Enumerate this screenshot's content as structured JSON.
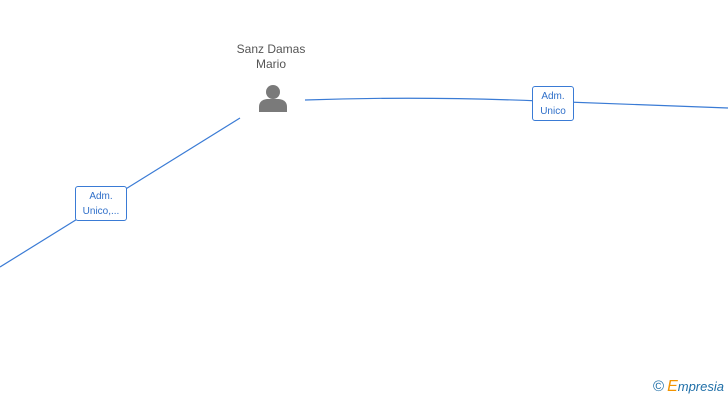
{
  "nodes": {
    "person": {
      "name_line1": "Sanz Damas",
      "name_line2": "Mario",
      "icon": "person-icon",
      "icon_color": "#7a7a7a"
    }
  },
  "edges": {
    "color": "#3a7bd5",
    "left": {
      "label_line1": "Adm.",
      "label_line2": "Unico,..."
    },
    "right": {
      "label_line1": "Adm.",
      "label_line2": "Unico"
    }
  },
  "footer": {
    "copyright_symbol": "©",
    "brand_first_letter": "E",
    "brand_rest": "mpresia"
  }
}
